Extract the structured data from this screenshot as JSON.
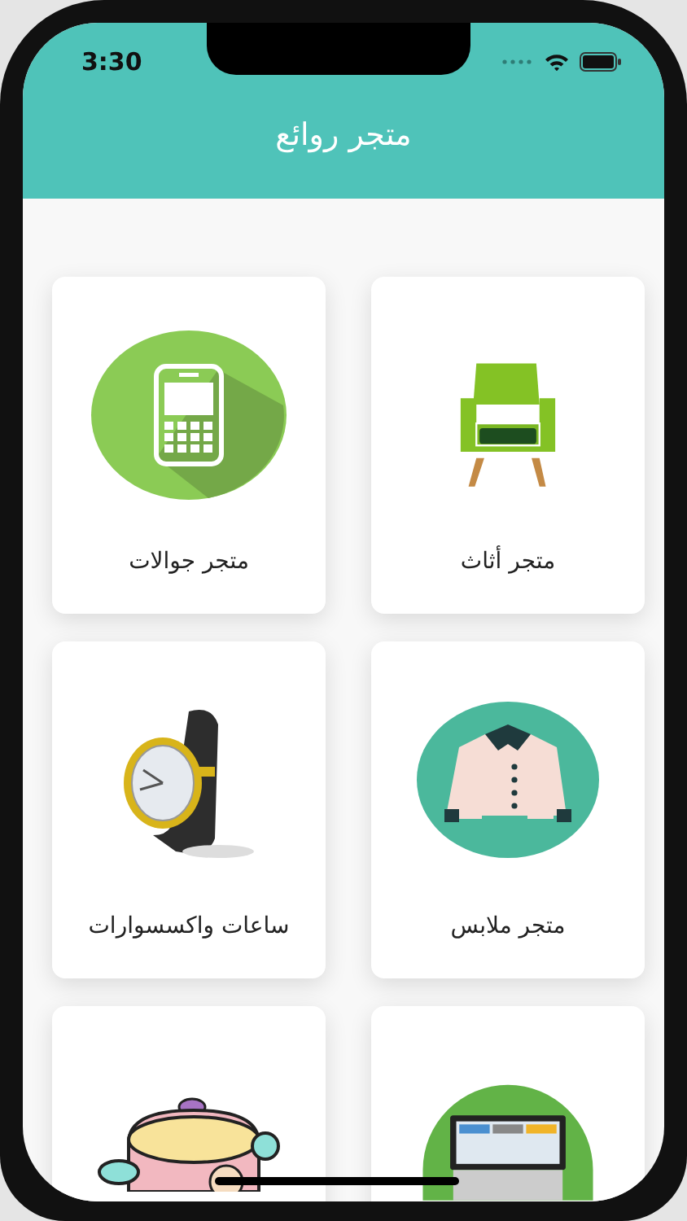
{
  "status_bar": {
    "time": "3:30"
  },
  "header": {
    "title": "متجر روائع"
  },
  "stores": [
    {
      "kind": "furniture",
      "label": "متجر أثاث"
    },
    {
      "kind": "phones",
      "label": "متجر جوالات"
    },
    {
      "kind": "clothes",
      "label": "متجر ملابس"
    },
    {
      "kind": "watches",
      "label": "ساعات واكسسوارات"
    },
    {
      "kind": "computers"
    },
    {
      "kind": "kitchen"
    }
  ]
}
